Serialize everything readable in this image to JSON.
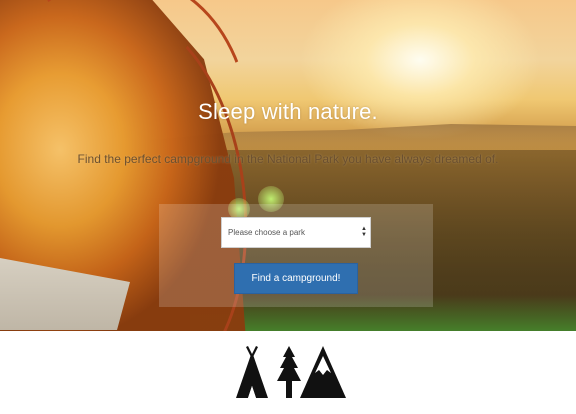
{
  "hero": {
    "title": "Sleep with nature.",
    "subtitle": "Find the perfect campground in the National Park you have always dreamed of."
  },
  "search": {
    "park_select_value": "Please choose a park",
    "submit_label": "Find a campground!"
  },
  "footer": {
    "icons": [
      "teepee-icon",
      "pine-tree-icon",
      "mountain-icon"
    ]
  },
  "colors": {
    "button_bg": "#2f6fb0",
    "icon": "#111111"
  }
}
